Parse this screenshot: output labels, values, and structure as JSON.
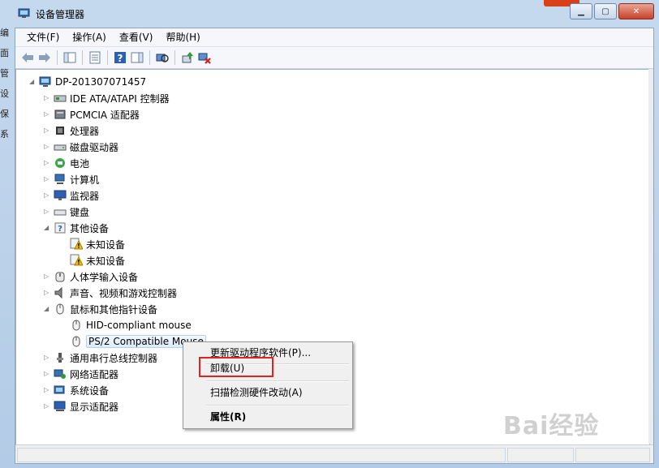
{
  "window": {
    "title": "设备管理器"
  },
  "background_peek": [
    "编",
    "面",
    "管",
    "设",
    "保",
    "系"
  ],
  "menu": [
    "文件(F)",
    "操作(A)",
    "查看(V)",
    "帮助(H)"
  ],
  "tree": {
    "root": "DP-201307071457",
    "items": [
      {
        "label": "IDE ATA/ATAPI 控制器",
        "icon": "ide-controller-icon",
        "expanded": false
      },
      {
        "label": "PCMCIA 适配器",
        "icon": "pcmcia-icon",
        "expanded": false
      },
      {
        "label": "处理器",
        "icon": "processor-icon",
        "expanded": false
      },
      {
        "label": "磁盘驱动器",
        "icon": "disk-drive-icon",
        "expanded": false
      },
      {
        "label": "电池",
        "icon": "battery-icon",
        "expanded": false
      },
      {
        "label": "计算机",
        "icon": "computer-icon",
        "expanded": false
      },
      {
        "label": "监视器",
        "icon": "monitor-icon",
        "expanded": false
      },
      {
        "label": "键盘",
        "icon": "keyboard-icon",
        "expanded": false
      },
      {
        "label": "其他设备",
        "icon": "other-devices-icon",
        "expanded": true,
        "children": [
          {
            "label": "未知设备",
            "icon": "unknown-device-warning-icon"
          },
          {
            "label": "未知设备",
            "icon": "unknown-device-warning-icon"
          }
        ]
      },
      {
        "label": "人体学输入设备",
        "icon": "hid-icon",
        "expanded": false
      },
      {
        "label": "声音、视频和游戏控制器",
        "icon": "sound-icon",
        "expanded": false
      },
      {
        "label": "鼠标和其他指针设备",
        "icon": "mouse-icon",
        "expanded": true,
        "children": [
          {
            "label": "HID-compliant mouse",
            "icon": "mouse-icon"
          },
          {
            "label": "PS/2 Compatible Mouse",
            "icon": "mouse-icon",
            "selected": true
          }
        ]
      },
      {
        "label": "通用串行总线控制器",
        "icon": "usb-icon",
        "expanded": false
      },
      {
        "label": "网络适配器",
        "icon": "network-adapter-icon",
        "expanded": false
      },
      {
        "label": "系统设备",
        "icon": "system-devices-icon",
        "expanded": false
      },
      {
        "label": "显示适配器",
        "icon": "display-adapter-icon",
        "expanded": false
      }
    ]
  },
  "context_menu": {
    "items": [
      "更新驱动程序软件(P)...",
      "卸载(U)",
      "扫描检测硬件改动(A)",
      "属性(R)"
    ],
    "highlighted": "卸载(U)"
  },
  "watermark": "Bai经验",
  "colors": {
    "highlight_box": "#e0231f",
    "selection": "#dcebfc",
    "close_button": "#c7422a"
  }
}
